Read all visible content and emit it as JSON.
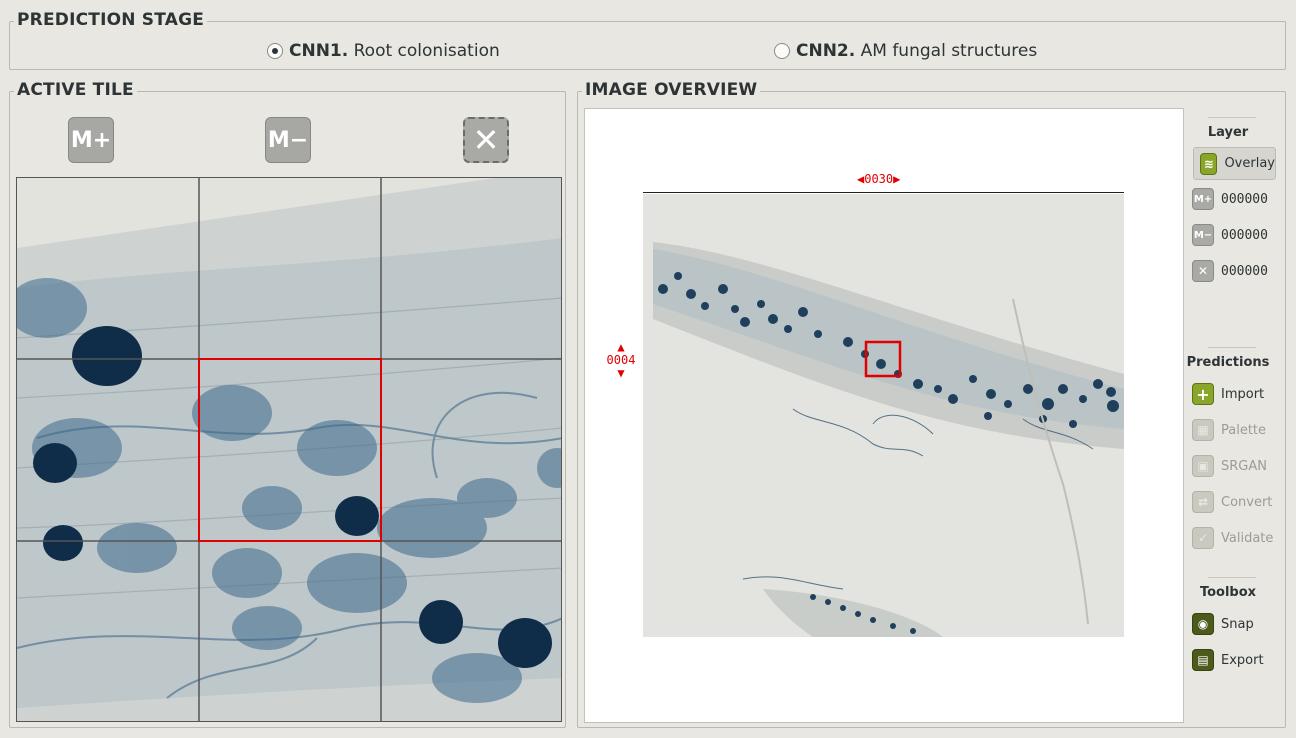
{
  "prediction_stage": {
    "title": "PREDICTION STAGE",
    "options": [
      {
        "bold": "CNN1.",
        "text": " Root colonisation",
        "selected": true
      },
      {
        "bold": "CNN2.",
        "text": " AM fungal structures",
        "selected": false
      }
    ]
  },
  "active_tile": {
    "title": "ACTIVE TILE",
    "buttons": {
      "m_plus": "M+",
      "m_minus": "M−",
      "clear": "✕"
    }
  },
  "image_overview": {
    "title": "IMAGE OVERVIEW",
    "x_coord": "0030",
    "y_coord": "0004"
  },
  "layer": {
    "title": "Layer",
    "overlay": "Overlay",
    "m_plus_icon": "M+",
    "m_plus_count": "000000",
    "m_minus_icon": "M−",
    "m_minus_count": "000000",
    "clear_icon": "✕",
    "clear_count": "000000"
  },
  "predictions": {
    "title": "Predictions",
    "import": "Import",
    "palette": "Palette",
    "srgan": "SRGAN",
    "convert": "Convert",
    "validate": "Validate"
  },
  "toolbox": {
    "title": "Toolbox",
    "snap": "Snap",
    "export": "Export"
  },
  "colors": {
    "accent_green": "#8aa62a",
    "selection_red": "#e00000",
    "stain_blue": "#1f3f5c"
  }
}
